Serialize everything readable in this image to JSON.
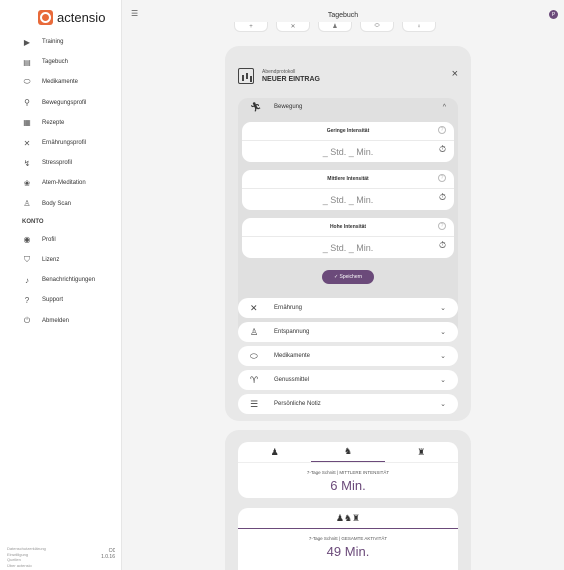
{
  "app": {
    "logo_text": "actensio",
    "brand_color": "#e86a3a",
    "accent_color": "#6b4a7a"
  },
  "topbar": {
    "title": "Tagebuch",
    "menu_icon": "menu-collapse-icon",
    "badge": "P"
  },
  "sidebar": {
    "items": [
      {
        "label": "Training",
        "icon": "play-icon",
        "glyph": "▶"
      },
      {
        "label": "Tagebuch",
        "icon": "diary-icon",
        "glyph": "▤"
      },
      {
        "label": "Medikamente",
        "icon": "pill-icon",
        "glyph": "⬭"
      },
      {
        "label": "Bewegungsprofil",
        "icon": "walking-icon",
        "glyph": "⚲"
      },
      {
        "label": "Rezepte",
        "icon": "recipe-icon",
        "glyph": "▦"
      },
      {
        "label": "Ernährungsprofil",
        "icon": "cutlery-icon",
        "glyph": "✕"
      },
      {
        "label": "Stressprofil",
        "icon": "stress-icon",
        "glyph": "↯"
      },
      {
        "label": "Atem-Meditation",
        "icon": "lotus-icon",
        "glyph": "❀"
      },
      {
        "label": "Body Scan",
        "icon": "bodyscan-icon",
        "glyph": "♙"
      }
    ],
    "section_label": "KONTO",
    "account_items": [
      {
        "label": "Profil",
        "icon": "profile-icon",
        "glyph": "◉"
      },
      {
        "label": "Lizenz",
        "icon": "shield-icon",
        "glyph": "⛉"
      },
      {
        "label": "Benachrichtigungen",
        "icon": "bell-icon",
        "glyph": "♪"
      },
      {
        "label": "Support",
        "icon": "help-icon",
        "glyph": "?"
      },
      {
        "label": "Abmelden",
        "icon": "logout-icon",
        "glyph": "⏻"
      }
    ],
    "footer": {
      "links": [
        "Datenschutzerklärung",
        "Einwilligung",
        "Quellen",
        "Über actensio"
      ],
      "ce": "C€",
      "version": "1.0.16"
    }
  },
  "strip": {
    "buttons": [
      "+",
      "✕",
      "♟",
      "⬭",
      "♀"
    ]
  },
  "entry": {
    "sub_title": "Abendprotokoll",
    "title": "NEUER EINTRAG",
    "close": "×",
    "open_section": {
      "label": "Bewegung",
      "icon": "running-icon",
      "glyph": "🏃︎",
      "chevron": "^"
    },
    "intensities": [
      {
        "title": "Geringe Intensität",
        "value": "_ Std. _ Min."
      },
      {
        "title": "Mittlere Intensität",
        "value": "_ Std. _ Min."
      },
      {
        "title": "Hohe Intensität",
        "value": "_ Std. _ Min."
      }
    ],
    "save_label": "✓ Speichern",
    "sections": [
      {
        "label": "Ernährung",
        "icon": "cutlery-icon",
        "glyph": "✕"
      },
      {
        "label": "Entspannung",
        "icon": "relax-icon",
        "glyph": "♙"
      },
      {
        "label": "Medikamente",
        "icon": "pill-icon",
        "glyph": "⬭"
      },
      {
        "label": "Genussmittel",
        "icon": "glass-icon",
        "glyph": "♈"
      },
      {
        "label": "Persönliche Notiz",
        "icon": "note-icon",
        "glyph": "☰"
      }
    ]
  },
  "stats": {
    "tab_icons": [
      "♟",
      "♞",
      "♜"
    ],
    "card1_label": "7-Tage Schnitt | MITTLERE INTENSITÄT",
    "card1_value": "6 Min.",
    "card2_icons": "♟♞♜",
    "card2_label": "7-Tage Schnitt | GESAMTE AKTIVITÄT",
    "card2_value": "49 Min."
  }
}
